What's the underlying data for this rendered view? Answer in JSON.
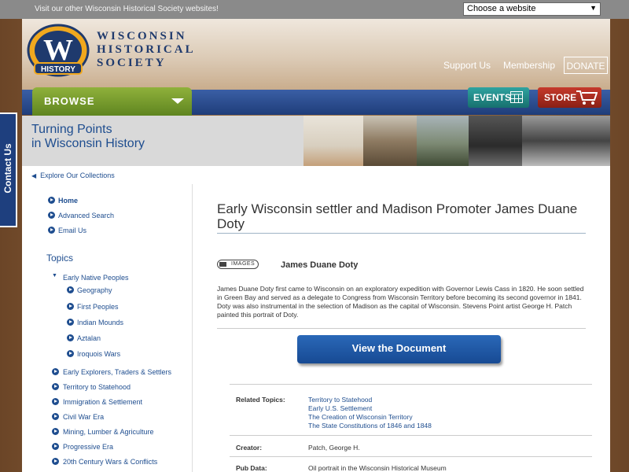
{
  "topbar": {
    "visit_text": "Visit our other Wisconsin Historical Society websites!",
    "site_select_value": "Choose a website"
  },
  "logo": {
    "badge_letter": "W",
    "badge_word": "HISTORY",
    "line1": "WISCONSIN",
    "line2": "HISTORICAL",
    "line3": "SOCIETY"
  },
  "util_links": {
    "support": "Support Us",
    "membership": "Membership",
    "donate": "DONATE"
  },
  "nav": {
    "browse": "BROWSE",
    "events": "EVENTS",
    "store": "STORE"
  },
  "banner": {
    "title_line1": "Turning Points",
    "title_line2": "in Wisconsin History"
  },
  "contact_tab": "Contact Us",
  "left": {
    "explore": "Explore Our Collections",
    "links": [
      "Home",
      "Advanced Search",
      "Email Us"
    ],
    "topics_heading": "Topics",
    "open_topic": "Early Native Peoples",
    "subtopics": [
      "Geography",
      "First Peoples",
      "Indian Mounds",
      "Aztalan",
      "Iroquois Wars"
    ],
    "topics": [
      "Early Explorers, Traders & Settlers",
      "Territory to Statehood",
      "Immigration & Settlement",
      "Civil War Era",
      "Mining, Lumber & Agriculture",
      "Progressive Era",
      "20th Century Wars & Conflicts"
    ]
  },
  "main": {
    "title": "Early Wisconsin settler and Madison Promoter James Duane Doty",
    "images_label": "IMAGES",
    "subtitle": "James Duane Doty",
    "description": "James Duane Doty first came to Wisconsin on an exploratory expedition with Governor Lewis Cass in 1820. He soon settled in Green Bay and served as a delegate to Congress from Wisconsin Territory before becoming its second governor in 1841. Doty was also instrumental in the selection of Madison as the capital of Wisconsin. Stevens Point artist George H. Patch painted this portrait of Doty.",
    "view_button": "View the Document",
    "related_label": "Related Topics:",
    "related_topics": [
      "Territory to Statehood",
      "Early U.S. Settlement",
      "The Creation of Wisconsin Territory",
      "The State Constitutions of 1846 and 1848"
    ],
    "creator_label": "Creator:",
    "creator_value": "Patch, George H.",
    "pub_label": "Pub Data:",
    "pub_value": "Oil portrait in the Wisconsin Historical Museum"
  },
  "colors": {
    "link_blue": "#1e4d8f",
    "nav_blue": "#1f3d7a",
    "browse_green": "#7aa030",
    "events_teal": "#2fa3a0",
    "store_red": "#b0302a"
  }
}
